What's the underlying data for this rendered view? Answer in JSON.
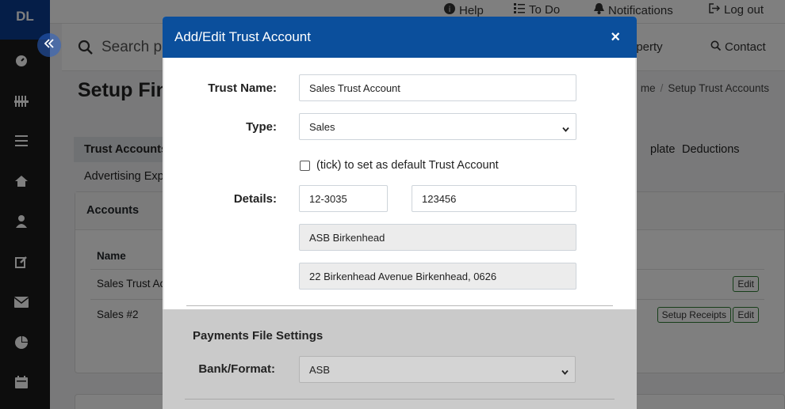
{
  "app": {
    "logo": "DL"
  },
  "topbar": {
    "help": "Help",
    "todo": "To Do",
    "notifications": "Notifications",
    "logout": "Log out"
  },
  "search": {
    "placeholder": "Search pr",
    "property_link": "roperty",
    "contact_link": "Contact"
  },
  "page": {
    "title": "Setup Fin",
    "breadcrumb_home": "me",
    "breadcrumb_current": "Setup Trust Accounts"
  },
  "tabs": {
    "trust_accounts": "Trust Accounts",
    "plate": "plate",
    "deductions": "Deductions",
    "advertising": "Advertising Exp"
  },
  "accounts_card": {
    "header": "Accounts",
    "col_name": "Name",
    "rows": [
      {
        "name": "Sales Trust Ac",
        "edit": "Edit"
      },
      {
        "name": "Sales #2",
        "setup": "Setup Receipts",
        "edit": "Edit"
      }
    ]
  },
  "modal": {
    "title": "Add/Edit Trust Account",
    "close": "×",
    "trust_name_label": "Trust Name:",
    "trust_name_value": "Sales Trust Account",
    "type_label": "Type:",
    "type_value": "Sales",
    "default_checkbox_label": "(tick) to set as default Trust Account",
    "default_checked": false,
    "details_label": "Details:",
    "account_prefix": "12-3035",
    "account_number": "123456",
    "bank_name": "ASB Birkenhead",
    "bank_address": "22 Birkenhead Avenue Birkenhead, 0626",
    "payments_section_title": "Payments File Settings",
    "bank_format_label": "Bank/Format:",
    "bank_format_value": "ASB"
  },
  "colors": {
    "modal_header": "#0b4f9c",
    "sidebar": "#1b1b1b",
    "logo_bg": "#0b3d91",
    "collapse_button": "#2a62c9"
  }
}
